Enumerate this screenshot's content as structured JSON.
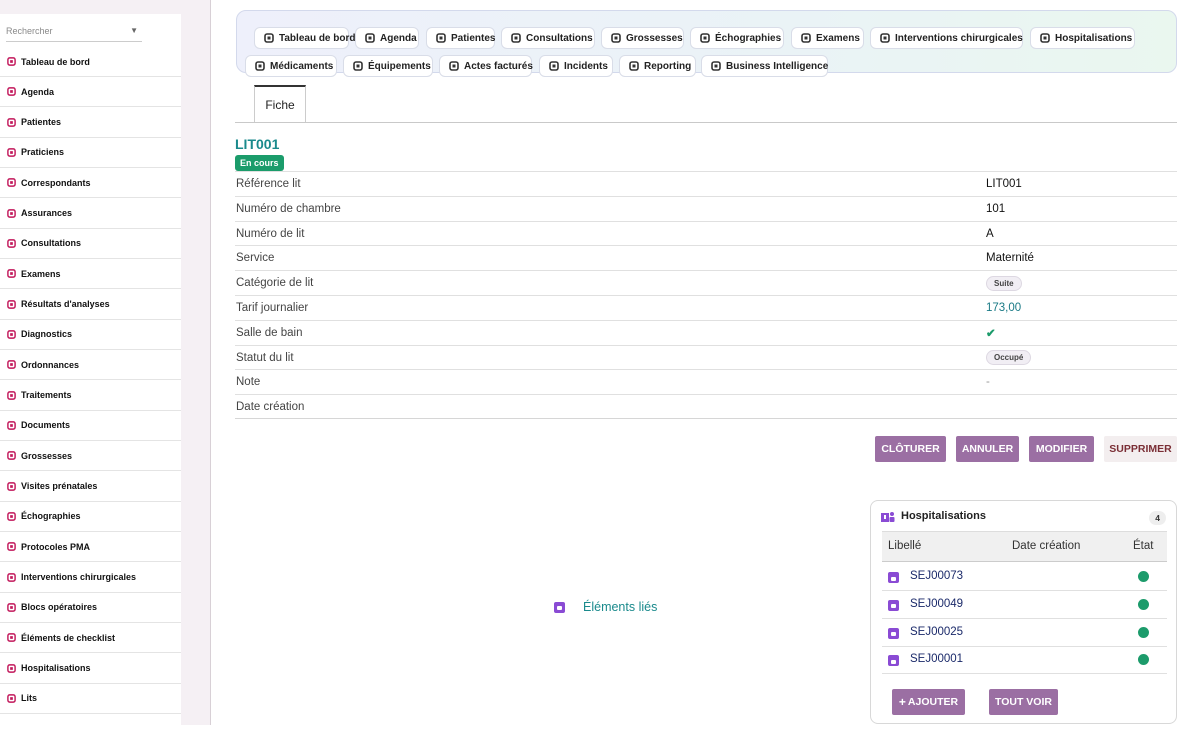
{
  "sidebar": {
    "search_placeholder": "Rechercher",
    "items": [
      {
        "label": "Tableau de bord",
        "icon": "dashboard-icon"
      },
      {
        "label": "Agenda",
        "icon": "calendar-icon"
      },
      {
        "label": "Patientes",
        "icon": "female-icon"
      },
      {
        "label": "Praticiens",
        "icon": "doctor-icon"
      },
      {
        "label": "Correspondants",
        "icon": "user-icon"
      },
      {
        "label": "Assurances",
        "icon": "shield-icon"
      },
      {
        "label": "Consultations",
        "icon": "stethoscope-icon"
      },
      {
        "label": "Examens",
        "icon": "microscope-icon"
      },
      {
        "label": "Résultats d'analyses",
        "icon": "vials-icon"
      },
      {
        "label": "Diagnostics",
        "icon": "clipboard-icon"
      },
      {
        "label": "Ordonnances",
        "icon": "prescription-icon"
      },
      {
        "label": "Traitements",
        "icon": "pills-icon"
      },
      {
        "label": "Documents",
        "icon": "file-icon"
      },
      {
        "label": "Grossesses",
        "icon": "baby-icon"
      },
      {
        "label": "Visites prénatales",
        "icon": "calendar-check-icon"
      },
      {
        "label": "Échographies",
        "icon": "ultrasound-icon"
      },
      {
        "label": "Protocoles PMA",
        "icon": "hourglass-icon"
      },
      {
        "label": "Interventions chirurgicales",
        "icon": "bed-surgery-icon"
      },
      {
        "label": "Blocs opératoires",
        "icon": "hospital-icon"
      },
      {
        "label": "Éléments de checklist",
        "icon": "checklist-icon"
      },
      {
        "label": "Hospitalisations",
        "icon": "hospital-user-icon"
      },
      {
        "label": "Lits",
        "icon": "bed-icon"
      }
    ],
    "accent": "#c2185b"
  },
  "topnav": {
    "items": [
      {
        "label": "Tableau de bord",
        "icon": "dashboard-icon"
      },
      {
        "label": "Agenda",
        "icon": "calendar-icon"
      },
      {
        "label": "Patientes",
        "icon": "female-icon"
      },
      {
        "label": "Consultations",
        "icon": "stethoscope-icon"
      },
      {
        "label": "Grossesses",
        "icon": "baby-icon"
      },
      {
        "label": "Échographies",
        "icon": "ultrasound-icon"
      },
      {
        "label": "Examens",
        "icon": "microscope-icon"
      },
      {
        "label": "Interventions chirurgicales",
        "icon": "bed-surgery-icon"
      },
      {
        "label": "Hospitalisations",
        "icon": "hospital-user-icon"
      },
      {
        "label": "Médicaments",
        "icon": "pills-icon"
      },
      {
        "label": "Équipements",
        "icon": "heart-pulse-icon"
      },
      {
        "label": "Actes facturés",
        "icon": "invoice-icon"
      },
      {
        "label": "Incidents",
        "icon": "warning-icon"
      },
      {
        "label": "Reporting",
        "icon": "pie-chart-icon"
      },
      {
        "label": "Business Intelligence",
        "icon": "line-chart-icon"
      }
    ]
  },
  "tabs": [
    {
      "label": "Fiche"
    }
  ],
  "record": {
    "title": "LIT001",
    "status": "En cours",
    "status_color": "#1b9c6b",
    "fields": [
      {
        "label": "Référence lit",
        "value": "LIT001"
      },
      {
        "label": "Numéro de chambre",
        "value": "101"
      },
      {
        "label": "Numéro de lit",
        "value": "A"
      },
      {
        "label": "Service",
        "value": "Maternité"
      },
      {
        "label": "Catégorie de lit",
        "value": "Suite"
      },
      {
        "label": "Tarif journalier",
        "value": "173,00"
      },
      {
        "label": "Salle de bain",
        "value": "✔"
      },
      {
        "label": "Statut du lit",
        "value": "Occupé"
      },
      {
        "label": "Note",
        "value": "-"
      },
      {
        "label": "Date création",
        "value": ""
      }
    ]
  },
  "actions": {
    "close": "CLÔTURER",
    "cancel": "ANNULER",
    "edit": "MODIFIER",
    "delete": "SUPPRIMER"
  },
  "linked": {
    "label": "Éléments liés"
  },
  "hospitalisations": {
    "title": "Hospitalisations",
    "count": "4",
    "columns": [
      "Libellé",
      "Date création",
      "État"
    ],
    "rows": [
      {
        "code": "SEJ00073",
        "date": "",
        "state_color": "#1c9b6b"
      },
      {
        "code": "SEJ00049",
        "date": "",
        "state_color": "#1c9b6b"
      },
      {
        "code": "SEJ00025",
        "date": "",
        "state_color": "#1c9b6b"
      },
      {
        "code": "SEJ00001",
        "date": "",
        "state_color": "#1c9b6b"
      }
    ],
    "add_label": "AJOUTER",
    "see_all_label": "TOUT VOIR"
  }
}
